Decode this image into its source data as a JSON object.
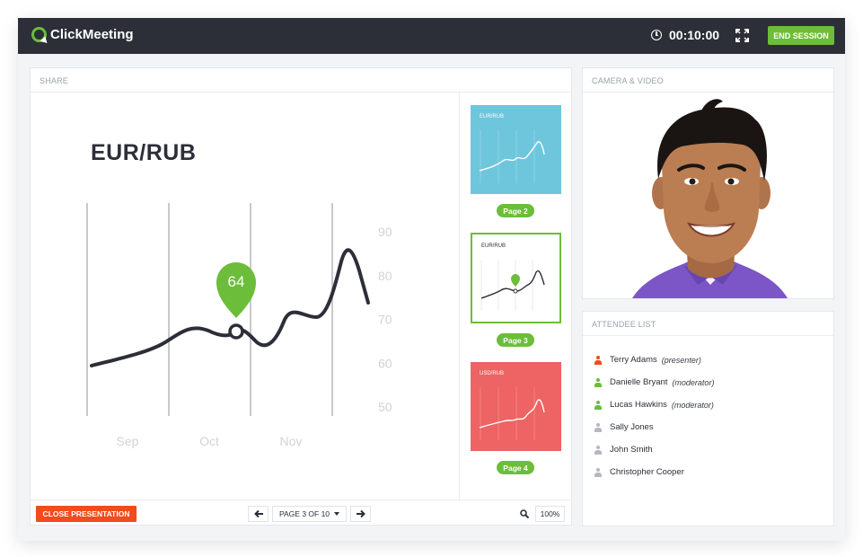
{
  "app": {
    "name": "ClickMeeting",
    "timer": "00:10:00",
    "end_session_label": "END SESSION"
  },
  "share": {
    "header": "SHARE",
    "slide_title": "EUR/RUB",
    "close_label": "CLOSE PRESENTATION",
    "page_label": "PAGE 3 OF 10",
    "zoom": "100%",
    "thumbnails": [
      {
        "title": "EUR/RUB",
        "page": "Page 2",
        "color": "#6ec6dc",
        "selected": false
      },
      {
        "title": "EUR/RUB",
        "page": "Page 3",
        "color": "#ffffff",
        "selected": true
      },
      {
        "title": "USD/RUB",
        "page": "Page 4",
        "color": "#ee6363",
        "selected": false
      }
    ]
  },
  "chart_data": {
    "type": "line",
    "title": "EUR/RUB",
    "x_ticks": [
      "Sep",
      "Oct",
      "Nov"
    ],
    "y_ticks": [
      90,
      80,
      70,
      60,
      50
    ],
    "ylim": [
      50,
      90
    ],
    "highlight": {
      "label": "64",
      "x": "Oct",
      "value": 67
    },
    "grid": "vertical"
  },
  "camera": {
    "header": "CAMERA & VIDEO"
  },
  "attendees": {
    "header": "ATTENDEE LIST",
    "list": [
      {
        "name": "Terry Adams",
        "role": "(presenter)",
        "color": "#f24b1d"
      },
      {
        "name": "Danielle Bryant",
        "role": "(moderator)",
        "color": "#6cbd3a"
      },
      {
        "name": "Lucas Hawkins",
        "role": "(moderator)",
        "color": "#6cbd3a"
      },
      {
        "name": "Sally Jones",
        "role": "",
        "color": "#b4b8c0"
      },
      {
        "name": "John Smith",
        "role": "",
        "color": "#b4b8c0"
      },
      {
        "name": "Christopher Cooper",
        "role": "",
        "color": "#b4b8c0"
      }
    ]
  },
  "colors": {
    "accent_green": "#6cbd3a",
    "danger_orange": "#f24b1d",
    "topbar": "#2c2f38"
  }
}
